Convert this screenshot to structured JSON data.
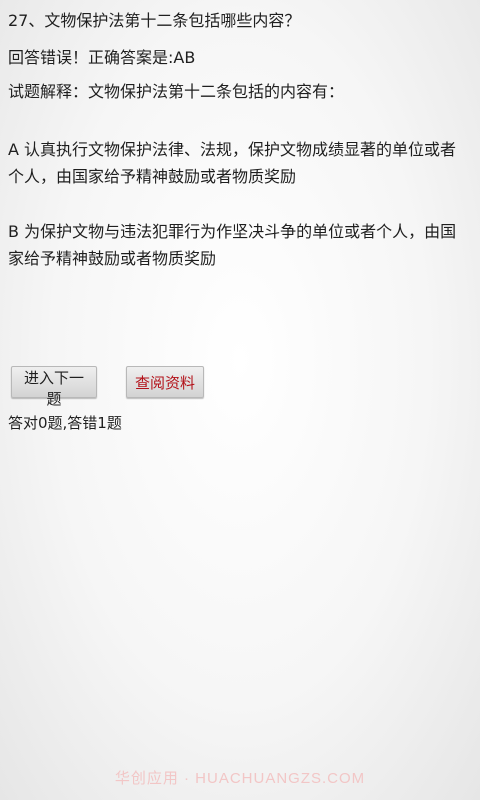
{
  "quiz": {
    "question": "27、文物保护法第十二条包括哪些内容？",
    "result": "回答错误！正确答案是:AB",
    "explanation_title": "试题解释：文物保护法第十二条包括的内容有：",
    "options": [
      "A  认真执行文物保护法律、法规，保护文物成绩显著的单位或者个人，由国家给予精神鼓励或者物质奖励",
      "B  为保护文物与违法犯罪行为作坚决斗争的单位或者个人，由国家给予精神鼓励或者物质奖励"
    ],
    "buttons": {
      "next_label": "进入下一题",
      "reference_label": "查阅资料"
    },
    "score": "答对0题,答错1题"
  },
  "watermark": "华创应用 · HUACHUANGZS.COM",
  "colors": {
    "reference_button_text": "#b3121a",
    "watermark": "#f2c6c6"
  }
}
